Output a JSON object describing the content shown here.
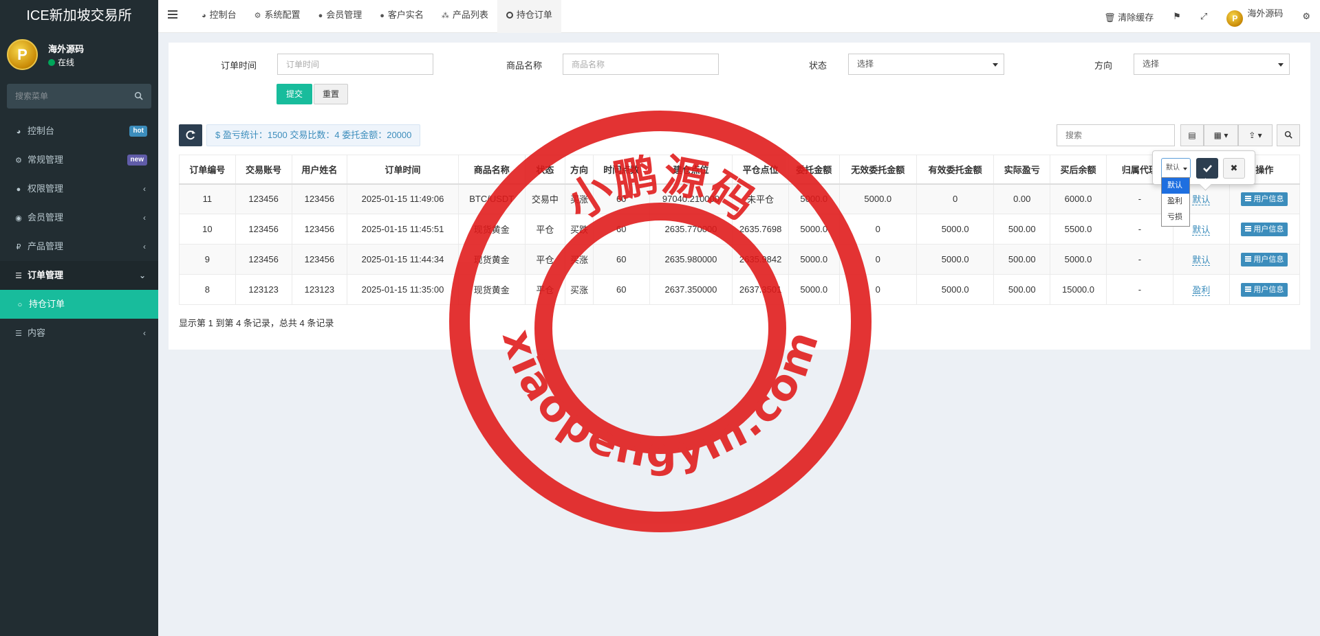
{
  "brand": "ICE新加坡交易所",
  "user": {
    "name": "海外源码",
    "status": "在线",
    "avatar_icon": "avatar-coin-icon"
  },
  "sidebar": {
    "search_placeholder": "搜索菜单",
    "items": [
      {
        "label": "控制台",
        "icon": "dashboard-icon",
        "badge": "hot"
      },
      {
        "label": "常规管理",
        "icon": "cogs-icon",
        "badge": "new"
      },
      {
        "label": "权限管理",
        "icon": "group-icon"
      },
      {
        "label": "会员管理",
        "icon": "user-circle-icon"
      },
      {
        "label": "产品管理",
        "icon": "ruble-icon"
      },
      {
        "label": "订单管理",
        "icon": "list-icon"
      },
      {
        "label": "持仓订单",
        "icon": "circle-o-icon"
      },
      {
        "label": "内容",
        "icon": "list-icon"
      }
    ]
  },
  "topnav": {
    "tabs": [
      {
        "label": "控制台",
        "icon": "dashboard-icon"
      },
      {
        "label": "系统配置",
        "icon": "gear-icon"
      },
      {
        "label": "会员管理",
        "icon": "user-icon"
      },
      {
        "label": "客户实名",
        "icon": "user-icon"
      },
      {
        "label": "产品列表",
        "icon": "cubes-icon"
      },
      {
        "label": "持仓订单",
        "icon": "circle-o-icon"
      }
    ],
    "clear_cache": "清除缓存",
    "user_name": "海外源码"
  },
  "filters": {
    "order_time_label": "订单时间",
    "order_time_placeholder": "订单时间",
    "product_label": "商品名称",
    "product_placeholder": "商品名称",
    "status_label": "状态",
    "status_value": "选择",
    "direction_label": "方向",
    "direction_value": "选择",
    "submit": "提交",
    "reset": "重置"
  },
  "toolbar": {
    "stats": "$ 盈亏统计：1500 交易比数：4 委托金额：20000",
    "search_placeholder": "搜索"
  },
  "table": {
    "headers": [
      "订单编号",
      "交易账号",
      "用户姓名",
      "订单时间",
      "商品名称",
      "状态",
      "方向",
      "时间点数",
      "建仓点位",
      "平仓点位",
      "委托金额",
      "无效委托金额",
      "有效委托金额",
      "实际盈亏",
      "买后余额",
      "归属代理",
      "",
      "操作"
    ],
    "rows": [
      {
        "id": "11",
        "account": "123456",
        "name": "123456",
        "time": "2025-01-15 11:49:06",
        "product": "BTC/USDT",
        "status": "交易中",
        "direction": "买涨",
        "seconds": "60",
        "open": "97040.210000",
        "close": "未平仓",
        "amount": "5000.0",
        "invalid": "5000.0",
        "valid": "0",
        "pnl": "0.00",
        "balance": "6000.0",
        "agent": "-",
        "result": "默认",
        "action": "用户信息"
      },
      {
        "id": "10",
        "account": "123456",
        "name": "123456",
        "time": "2025-01-15 11:45:51",
        "product": "现货黄金",
        "status": "平仓",
        "direction": "买跌",
        "seconds": "60",
        "open": "2635.770000",
        "close": "2635.7698",
        "amount": "5000.0",
        "invalid": "0",
        "valid": "5000.0",
        "pnl": "500.00",
        "balance": "5500.0",
        "agent": "-",
        "result": "默认",
        "action": "用户信息"
      },
      {
        "id": "9",
        "account": "123456",
        "name": "123456",
        "time": "2025-01-15 11:44:34",
        "product": "现货黄金",
        "status": "平仓",
        "direction": "买涨",
        "seconds": "60",
        "open": "2635.980000",
        "close": "2635.9842",
        "amount": "5000.0",
        "invalid": "0",
        "valid": "5000.0",
        "pnl": "500.00",
        "balance": "5000.0",
        "agent": "-",
        "result": "默认",
        "action": "用户信息"
      },
      {
        "id": "8",
        "account": "123123",
        "name": "123123",
        "time": "2025-01-15 11:35:00",
        "product": "现货黄金",
        "status": "平仓",
        "direction": "买涨",
        "seconds": "60",
        "open": "2637.350000",
        "close": "2637.3501",
        "amount": "5000.0",
        "invalid": "0",
        "valid": "5000.0",
        "pnl": "500.00",
        "balance": "15000.0",
        "agent": "-",
        "result": "盈利",
        "action": "用户信息"
      }
    ],
    "pager": "显示第 1 到第 4 条记录，总共 4 条记录"
  },
  "popover": {
    "selected": "默认",
    "options": [
      "默认",
      "盈利",
      "亏损"
    ]
  },
  "watermark": {
    "cn": "小鹏源码",
    "url": "xiaopengym.com"
  },
  "colors": {
    "accent": "#18bc9c",
    "sidebar": "#222d32",
    "primary": "#3c8dbc",
    "danger": "#e74c3c",
    "stamp": "#e01818"
  }
}
